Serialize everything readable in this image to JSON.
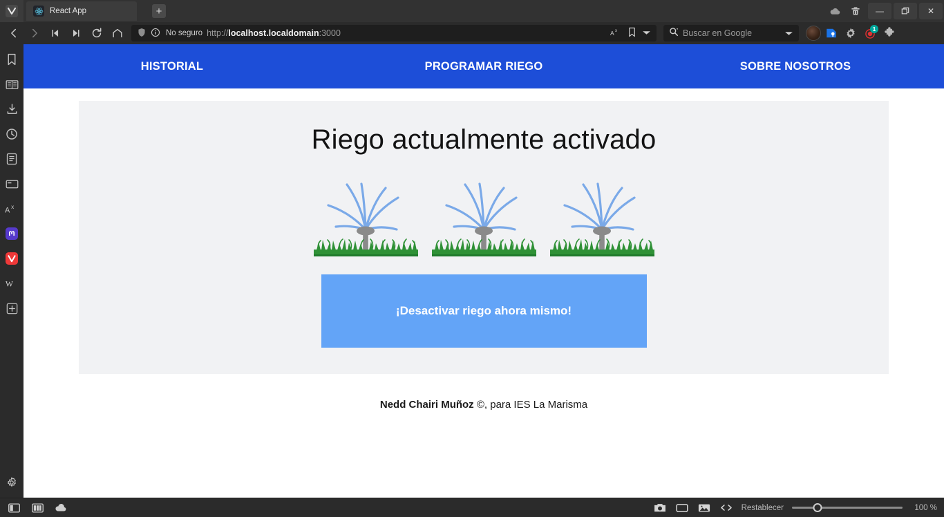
{
  "browser": {
    "app_name": "Vivaldi",
    "tab": {
      "title": "React App",
      "favicon": "react-atom-icon"
    },
    "new_tab_label": "+",
    "window_controls": {
      "minimize": "—",
      "maximize": "❐",
      "close": "✕"
    },
    "toolbar": {
      "back": "back-icon",
      "forward": "forward-icon",
      "rewind": "rewind-icon",
      "fast_forward": "fast-forward-icon",
      "reload": "reload-icon",
      "home": "home-icon"
    },
    "address": {
      "security_label": "No seguro",
      "url_scheme": "http://",
      "url_host": "localhost.localdomain",
      "url_port": ":3000"
    },
    "search": {
      "placeholder": "Buscar en Google",
      "engine": "Google"
    },
    "extension_badge": "1",
    "panel_items": [
      {
        "name": "bookmarks",
        "icon": "bookmark-icon"
      },
      {
        "name": "reading-list",
        "icon": "book-icon"
      },
      {
        "name": "downloads",
        "icon": "download-icon"
      },
      {
        "name": "history",
        "icon": "clock-icon"
      },
      {
        "name": "notes",
        "icon": "notes-icon"
      },
      {
        "name": "window-panel",
        "icon": "window-icon"
      },
      {
        "name": "translate",
        "icon": "translate-icon"
      },
      {
        "name": "mastodon",
        "icon": "mastodon-icon"
      },
      {
        "name": "vivaldi-community",
        "icon": "vivaldi-icon"
      },
      {
        "name": "wikipedia",
        "icon": "wikipedia-icon"
      },
      {
        "name": "add-panel",
        "icon": "plus-icon"
      },
      {
        "name": "panel-settings",
        "icon": "gear-icon"
      }
    ],
    "statusbar": {
      "reset_label": "Restablecer",
      "zoom_value": "100 %",
      "zoom_percent": 23,
      "icons": [
        "panel-toggle-icon",
        "tile-icon",
        "cloud-icon",
        "capture-icon",
        "tiling-icon",
        "image-icon",
        "developer-icon"
      ]
    }
  },
  "page": {
    "nav": {
      "items": [
        {
          "label": "Historial",
          "display": "HISTORIAL"
        },
        {
          "label": "Programar riego",
          "display": "PROGRAMAR RIEGO"
        },
        {
          "label": "Sobre nosotros",
          "display": "SOBRE NOSOTROS"
        }
      ],
      "background_color": "#1d4ed8"
    },
    "main": {
      "title": "Riego actualmente activado",
      "sprinkler_count": 3,
      "sprinkler_alt": "sprinkler-watering-grass",
      "cta_label": "¡Desactivar riego ahora mismo!",
      "cta_color": "#63a4f7",
      "card_color": "#f1f2f4"
    },
    "footer": {
      "author": "Nedd Chairi Muñoz",
      "rest": " ©, para IES La Marisma"
    }
  }
}
